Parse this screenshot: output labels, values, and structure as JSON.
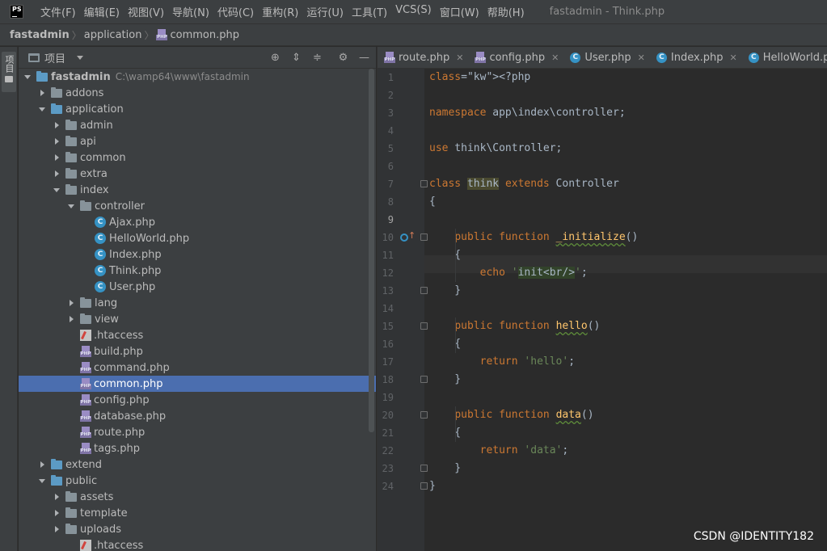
{
  "menubar": {
    "logo": "PS",
    "items": [
      "文件(F)",
      "编辑(E)",
      "视图(V)",
      "导航(N)",
      "代码(C)",
      "重构(R)",
      "运行(U)",
      "工具(T)",
      "VCS(S)",
      "窗口(W)",
      "帮助(H)"
    ],
    "window_title": "fastadmin - Think.php"
  },
  "breadcrumb": {
    "project": "fastadmin",
    "folder": "application",
    "file": "common.php"
  },
  "left_stripe": {
    "project_label": "项目"
  },
  "project_panel": {
    "title": "项目",
    "tree": [
      {
        "label": "fastadmin",
        "path": "C:\\wamp64\\www\\fastadmin",
        "kind": "folder-blue",
        "level": 0,
        "arrow": "down",
        "bold": true
      },
      {
        "label": "addons",
        "kind": "folder",
        "level": 1,
        "arrow": "right"
      },
      {
        "label": "application",
        "kind": "folder-blue",
        "level": 1,
        "arrow": "down"
      },
      {
        "label": "admin",
        "kind": "folder",
        "level": 2,
        "arrow": "right"
      },
      {
        "label": "api",
        "kind": "folder",
        "level": 2,
        "arrow": "right"
      },
      {
        "label": "common",
        "kind": "folder",
        "level": 2,
        "arrow": "right"
      },
      {
        "label": "extra",
        "kind": "folder",
        "level": 2,
        "arrow": "right"
      },
      {
        "label": "index",
        "kind": "folder",
        "level": 2,
        "arrow": "down"
      },
      {
        "label": "controller",
        "kind": "folder",
        "level": 3,
        "arrow": "down"
      },
      {
        "label": "Ajax.php",
        "kind": "class",
        "level": 4,
        "arrow": "none"
      },
      {
        "label": "HelloWorld.php",
        "kind": "class",
        "level": 4,
        "arrow": "none"
      },
      {
        "label": "Index.php",
        "kind": "class",
        "level": 4,
        "arrow": "none"
      },
      {
        "label": "Think.php",
        "kind": "class",
        "level": 4,
        "arrow": "none"
      },
      {
        "label": "User.php",
        "kind": "class",
        "level": 4,
        "arrow": "none"
      },
      {
        "label": "lang",
        "kind": "folder",
        "level": 3,
        "arrow": "right"
      },
      {
        "label": "view",
        "kind": "folder",
        "level": 3,
        "arrow": "right"
      },
      {
        "label": ".htaccess",
        "kind": "htaccess",
        "level": 3,
        "arrow": "none"
      },
      {
        "label": "build.php",
        "kind": "php",
        "level": 3,
        "arrow": "none"
      },
      {
        "label": "command.php",
        "kind": "php",
        "level": 3,
        "arrow": "none"
      },
      {
        "label": "common.php",
        "kind": "php",
        "level": 3,
        "arrow": "none",
        "selected": true
      },
      {
        "label": "config.php",
        "kind": "php",
        "level": 3,
        "arrow": "none"
      },
      {
        "label": "database.php",
        "kind": "php",
        "level": 3,
        "arrow": "none"
      },
      {
        "label": "route.php",
        "kind": "php",
        "level": 3,
        "arrow": "none"
      },
      {
        "label": "tags.php",
        "kind": "php",
        "level": 3,
        "arrow": "none"
      },
      {
        "label": "extend",
        "kind": "folder-blue",
        "level": 1,
        "arrow": "right"
      },
      {
        "label": "public",
        "kind": "folder-blue",
        "level": 1,
        "arrow": "down"
      },
      {
        "label": "assets",
        "kind": "folder",
        "level": 2,
        "arrow": "right"
      },
      {
        "label": "template",
        "kind": "folder",
        "level": 2,
        "arrow": "right"
      },
      {
        "label": "uploads",
        "kind": "folder",
        "level": 2,
        "arrow": "right"
      },
      {
        "label": ".htaccess",
        "kind": "htaccess",
        "level": 3,
        "arrow": "none"
      }
    ]
  },
  "editor": {
    "tabs": [
      {
        "label": "route.php",
        "icon": "php"
      },
      {
        "label": "config.php",
        "icon": "php"
      },
      {
        "label": "User.php",
        "icon": "class"
      },
      {
        "label": "Index.php",
        "icon": "class"
      },
      {
        "label": "HelloWorld.php",
        "icon": "class"
      }
    ],
    "current_line": 9,
    "code_lines": [
      "<?php",
      "",
      "namespace app\\index\\controller;",
      "",
      "use think\\Controller;",
      "",
      "class think extends Controller",
      "{",
      "",
      "    public function _initialize()",
      "    {",
      "        echo 'init<br/>';",
      "    }",
      "",
      "    public function hello()",
      "    {",
      "        return 'hello';",
      "    }",
      "",
      "    public function data()",
      "    {",
      "        return 'data';",
      "    }",
      "}"
    ]
  },
  "watermark": "CSDN @IDENTITY182"
}
